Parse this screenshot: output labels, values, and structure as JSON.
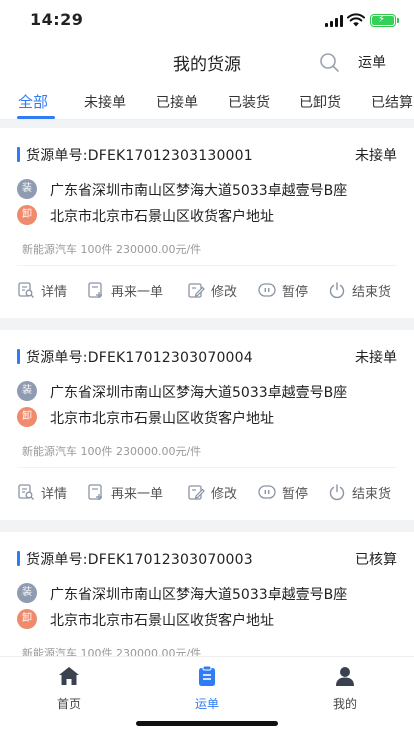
{
  "status_bar": {
    "time": "14:29"
  },
  "header": {
    "title": "我的货源",
    "waybill_label": "运单"
  },
  "tabs": [
    {
      "label": "全部",
      "active": true
    },
    {
      "label": "未接单"
    },
    {
      "label": "已接单"
    },
    {
      "label": "已装货"
    },
    {
      "label": "已卸货"
    },
    {
      "label": "已结算"
    }
  ],
  "orders": [
    {
      "order_no": "货源单号:DFEK17012303130001",
      "status": "未接单",
      "load_badge": "装",
      "load_address": "广东省深圳市南山区梦海大道5033卓越壹号B座",
      "unload_badge": "卸",
      "unload_address": "北京市北京市石景山区收货客户地址",
      "cargo": "新能源汽车 100件 230000.00元/件",
      "show_actions": true
    },
    {
      "order_no": "货源单号:DFEK17012303070004",
      "status": "未接单",
      "load_badge": "装",
      "load_address": "广东省深圳市南山区梦海大道5033卓越壹号B座",
      "unload_badge": "卸",
      "unload_address": "北京市北京市石景山区收货客户地址",
      "cargo": "新能源汽车 100件 230000.00元/件",
      "show_actions": true
    },
    {
      "order_no": "货源单号:DFEK17012303070003",
      "status": "已核算",
      "load_badge": "装",
      "load_address": "广东省深圳市南山区梦海大道5033卓越壹号B座",
      "unload_badge": "卸",
      "unload_address": "北京市北京市石景山区收货客户地址",
      "cargo": "新能源汽车 100件 230000.00元/件",
      "show_actions": false
    }
  ],
  "actions": {
    "details": "详情",
    "reorder": "再来一单",
    "edit": "修改",
    "pause": "暂停",
    "finish": "结束货"
  },
  "tabbar": [
    {
      "label": "首页",
      "icon": "home-icon",
      "active": false
    },
    {
      "label": "运单",
      "icon": "clipboard-icon",
      "active": true
    },
    {
      "label": "我的",
      "icon": "user-icon",
      "active": false
    }
  ],
  "colors": {
    "accent": "#2f7cf6",
    "load_badge": "#8e9bb0",
    "unload_badge": "#f08a6c"
  }
}
